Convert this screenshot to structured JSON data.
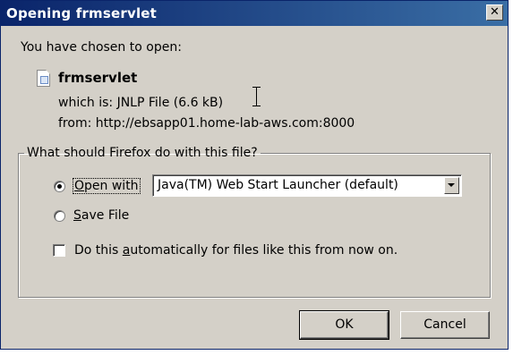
{
  "window": {
    "title": "Opening frmservlet",
    "close_glyph": "✕"
  },
  "intro": "You have chosen to open:",
  "file": {
    "icon": "jnlp-file-icon",
    "name": "frmservlet",
    "which_is": "which is:  JNLP File (6.6 kB)",
    "from": "from:  http://ebsapp01.home-lab-aws.com:8000"
  },
  "group": {
    "legend": "What should Firefox do with this file?",
    "open_with": {
      "prefix": "O",
      "rest": "pen with",
      "selected": true
    },
    "select": {
      "value": "Java(TM) Web Start Launcher (default)"
    },
    "save_file": {
      "prefix": "S",
      "rest": "ave File",
      "selected": false
    },
    "auto": {
      "before": "Do this ",
      "accel": "a",
      "after": "utomatically for files like this from now on.",
      "checked": false
    }
  },
  "buttons": {
    "ok": "OK",
    "cancel": "Cancel"
  }
}
